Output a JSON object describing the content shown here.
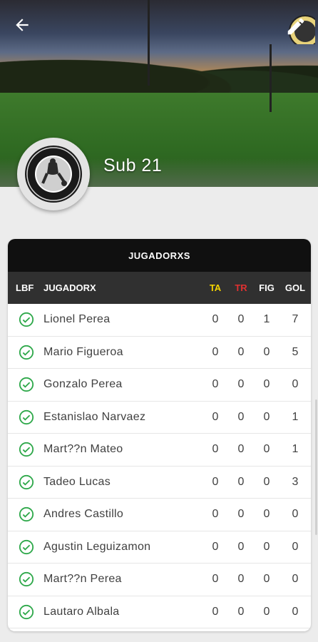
{
  "header": {
    "team_name": "Sub 21",
    "back_icon": "arrow-left-icon",
    "edit_icon": "pencil-icon",
    "logo_icon": "la-leyenda-logo"
  },
  "table": {
    "title": "JUGADORXS",
    "columns": {
      "lbf": "LBF",
      "player": "JUGADORX",
      "ta": "TA",
      "tr": "TR",
      "fig": "FIG",
      "gol": "GOL"
    },
    "column_colors": {
      "ta": "#f5d400",
      "tr": "#e03030"
    },
    "check_color": "#2ea84a",
    "rows": [
      {
        "name": "Lionel Perea",
        "ta": "0",
        "tr": "0",
        "fig": "1",
        "gol": "7"
      },
      {
        "name": "Mario Figueroa",
        "ta": "0",
        "tr": "0",
        "fig": "0",
        "gol": "5"
      },
      {
        "name": "Gonzalo Perea",
        "ta": "0",
        "tr": "0",
        "fig": "0",
        "gol": "0"
      },
      {
        "name": "Estanislao Narvaez",
        "ta": "0",
        "tr": "0",
        "fig": "0",
        "gol": "1"
      },
      {
        "name": "Mart??n Mateo",
        "ta": "0",
        "tr": "0",
        "fig": "0",
        "gol": "1"
      },
      {
        "name": "Tadeo Lucas",
        "ta": "0",
        "tr": "0",
        "fig": "0",
        "gol": "3"
      },
      {
        "name": "Andres Castillo",
        "ta": "0",
        "tr": "0",
        "fig": "0",
        "gol": "0"
      },
      {
        "name": "Agustin Leguizamon",
        "ta": "0",
        "tr": "0",
        "fig": "0",
        "gol": "0"
      },
      {
        "name": "Mart??n Perea",
        "ta": "0",
        "tr": "0",
        "fig": "0",
        "gol": "0"
      },
      {
        "name": "Lautaro Albala",
        "ta": "0",
        "tr": "0",
        "fig": "0",
        "gol": "0"
      }
    ]
  }
}
